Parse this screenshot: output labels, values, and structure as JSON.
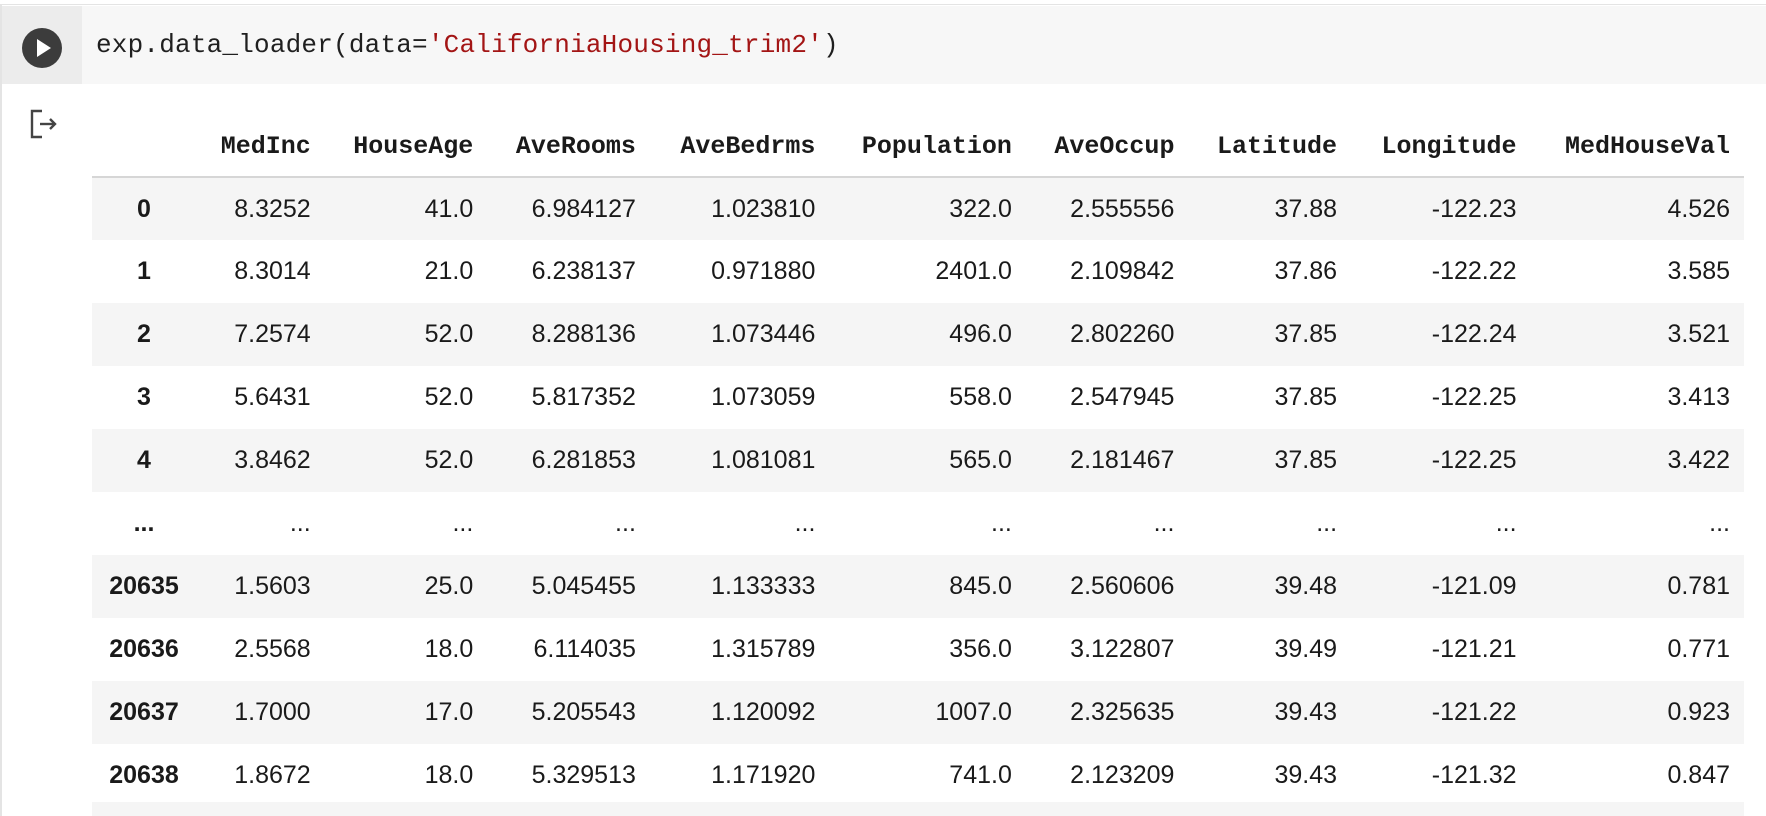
{
  "cell": {
    "code_prefix": "exp.data_loader(data=",
    "code_string": "'CaliforniaHousing_trim2'",
    "code_suffix": ")"
  },
  "icons": {
    "run": "play-icon",
    "output": "output-redirect-icon"
  },
  "colors": {
    "string_literal": "#a31515",
    "run_button": "#3c3c3c",
    "row_stripe": "#f5f5f5"
  },
  "table": {
    "columns": [
      "",
      "MedInc",
      "HouseAge",
      "AveRooms",
      "AveBedrms",
      "Population",
      "AveOccup",
      "Latitude",
      "Longitude",
      "MedHouseVal"
    ],
    "rows": [
      [
        "0",
        "8.3252",
        "41.0",
        "6.984127",
        "1.023810",
        "322.0",
        "2.555556",
        "37.88",
        "-122.23",
        "4.526"
      ],
      [
        "1",
        "8.3014",
        "21.0",
        "6.238137",
        "0.971880",
        "2401.0",
        "2.109842",
        "37.86",
        "-122.22",
        "3.585"
      ],
      [
        "2",
        "7.2574",
        "52.0",
        "8.288136",
        "1.073446",
        "496.0",
        "2.802260",
        "37.85",
        "-122.24",
        "3.521"
      ],
      [
        "3",
        "5.6431",
        "52.0",
        "5.817352",
        "1.073059",
        "558.0",
        "2.547945",
        "37.85",
        "-122.25",
        "3.413"
      ],
      [
        "4",
        "3.8462",
        "52.0",
        "6.281853",
        "1.081081",
        "565.0",
        "2.181467",
        "37.85",
        "-122.25",
        "3.422"
      ],
      [
        "...",
        "...",
        "...",
        "...",
        "...",
        "...",
        "...",
        "...",
        "...",
        "..."
      ],
      [
        "20635",
        "1.5603",
        "25.0",
        "5.045455",
        "1.133333",
        "845.0",
        "2.560606",
        "39.48",
        "-121.09",
        "0.781"
      ],
      [
        "20636",
        "2.5568",
        "18.0",
        "6.114035",
        "1.315789",
        "356.0",
        "3.122807",
        "39.49",
        "-121.21",
        "0.771"
      ],
      [
        "20637",
        "1.7000",
        "17.0",
        "5.205543",
        "1.120092",
        "1007.0",
        "2.325635",
        "39.43",
        "-121.22",
        "0.923"
      ],
      [
        "20638",
        "1.8672",
        "18.0",
        "5.329513",
        "1.171920",
        "741.0",
        "2.123209",
        "39.43",
        "-121.32",
        "0.847"
      ]
    ]
  }
}
